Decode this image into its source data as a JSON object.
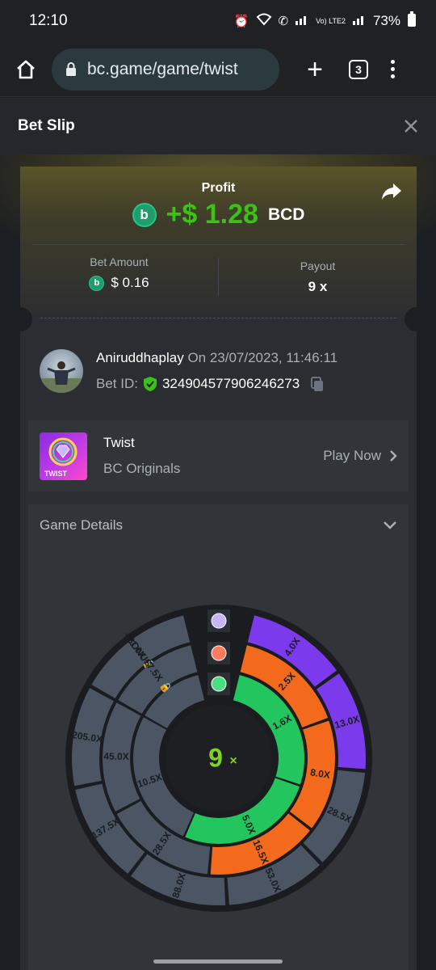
{
  "status_bar": {
    "time": "12:10",
    "battery": "73%",
    "network": "Vo) LTE2"
  },
  "browser": {
    "url": "bc.game/game/twist",
    "tab_count": "3"
  },
  "bet_slip": {
    "title": "Bet Slip",
    "profit_label": "Profit",
    "profit_amount": "+$ 1.28",
    "profit_currency": "BCD",
    "bet_amount_label": "Bet Amount",
    "bet_amount_value": "$ 0.16",
    "payout_label": "Payout",
    "payout_value": "9 x"
  },
  "user": {
    "name": "Aniruddhaplay",
    "date": "On 23/07/2023, 11:46:11",
    "bet_id_label": "Bet ID:",
    "bet_id": "324904577906246273"
  },
  "game": {
    "name": "Twist",
    "provider": "BC Originals",
    "play_now": "Play Now",
    "thumb_label": "TWIST"
  },
  "details": {
    "title": "Game Details"
  },
  "wheel": {
    "center_value": "9",
    "center_unit": "×",
    "bonus_label": "BONUS",
    "outer_ring": {
      "locked_label": "+21.0X",
      "active": [
        "4.0X",
        "13.0X"
      ],
      "inactive": [
        "28.5X",
        "53.0X",
        "88.0X",
        "137.5X",
        "205.0X"
      ]
    },
    "middle_ring": {
      "locked_label": "+7.5X",
      "active": [
        "2.5X",
        "8.0X",
        "16.5X"
      ],
      "inactive": [
        "28.5X",
        "45.0X"
      ]
    },
    "inner_ring": {
      "active": [
        "1.6X",
        "5.0X"
      ],
      "inactive": [
        "10.5X"
      ]
    },
    "colors": {
      "purple": "#7c3aed",
      "orange": "#f46a1d",
      "green": "#22c55e",
      "inactive": "#4b5563",
      "dark": "#1a1c20"
    }
  }
}
